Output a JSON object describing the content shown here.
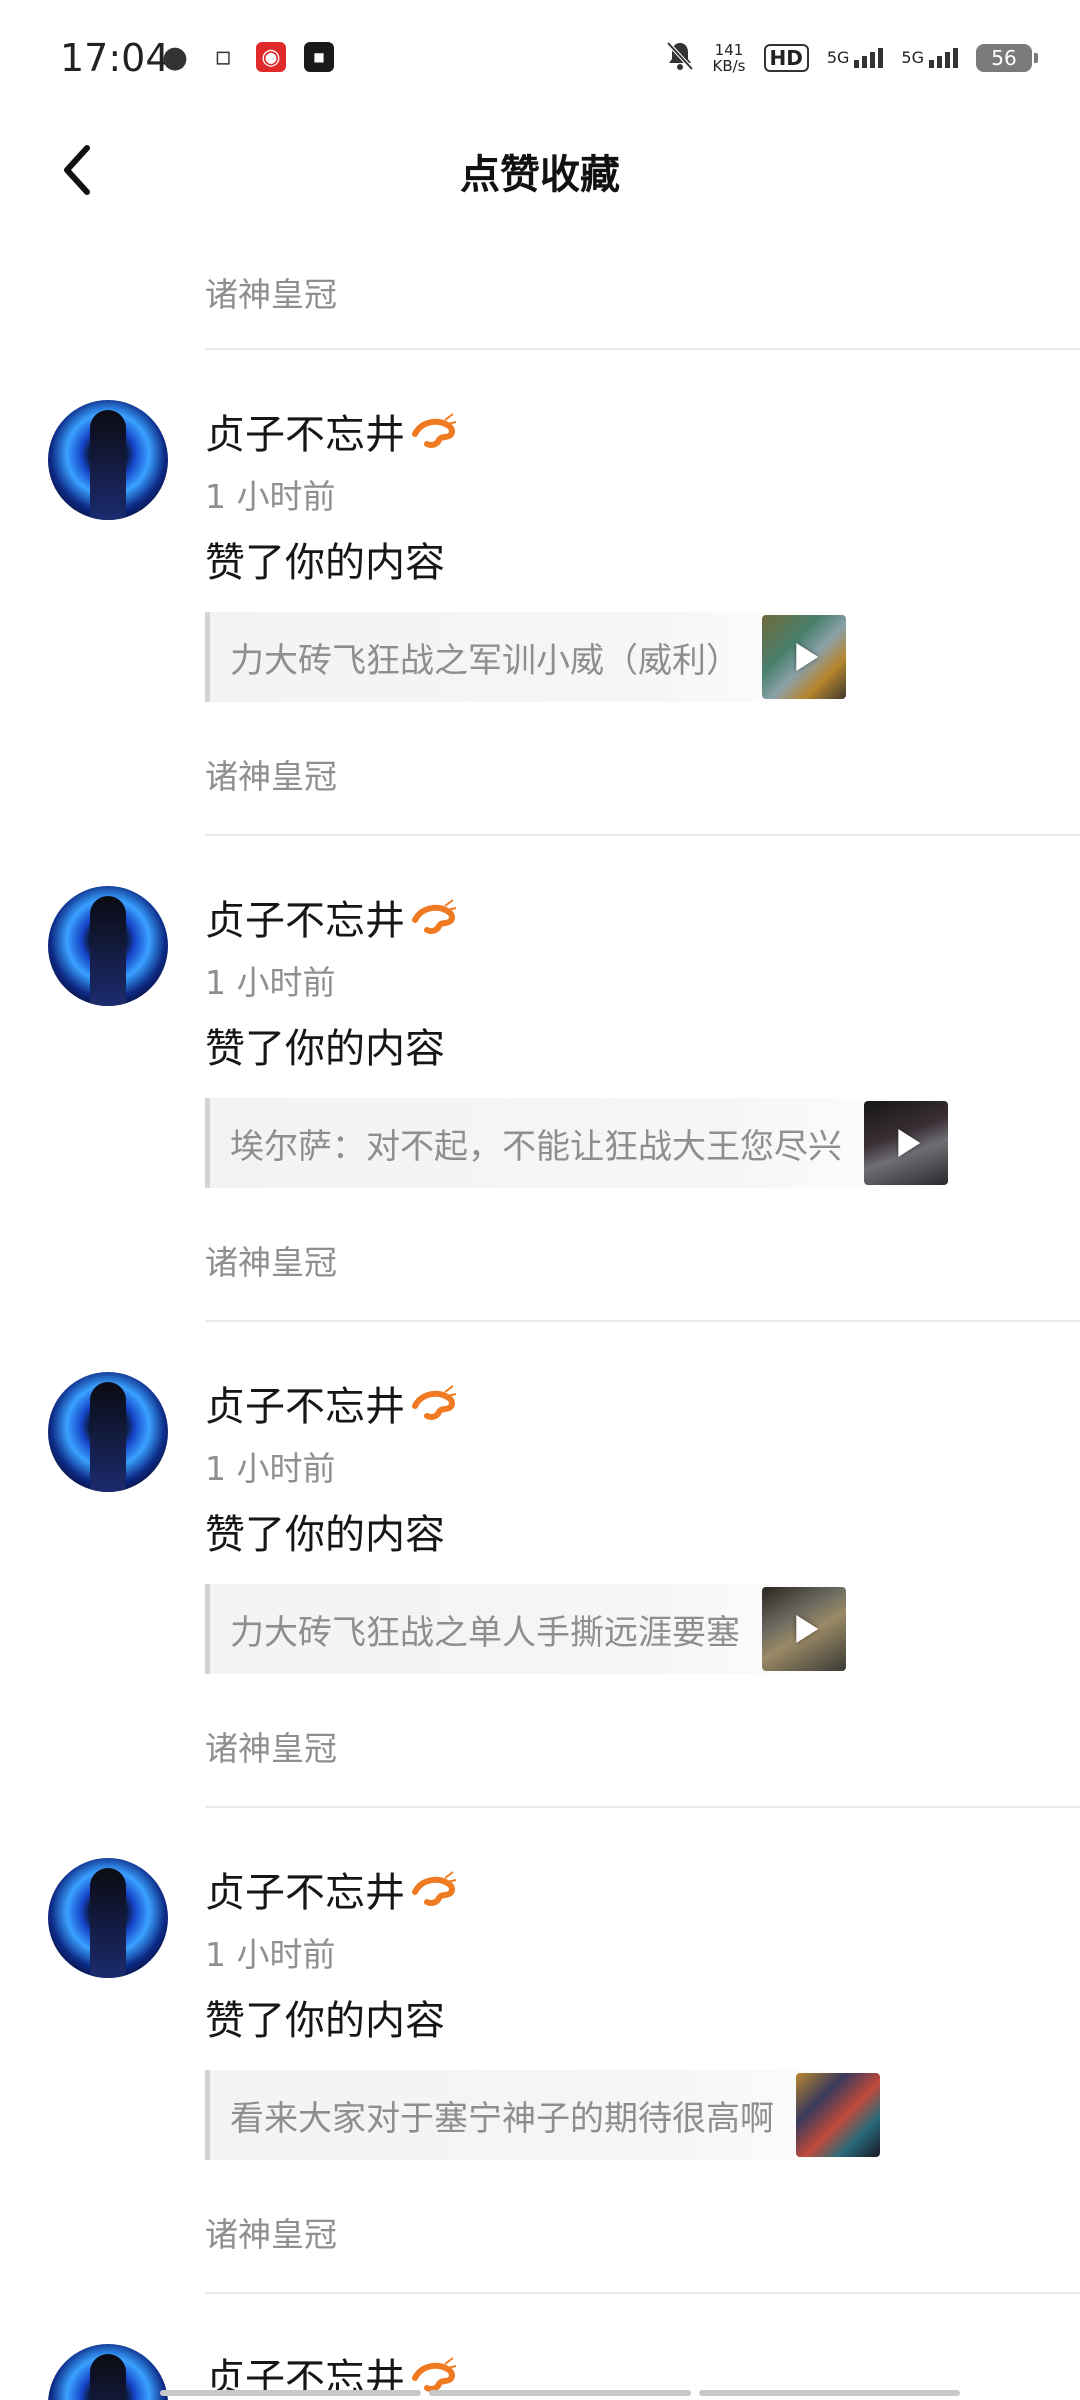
{
  "status_bar": {
    "time": "17:04",
    "net_speed_value": "141",
    "net_speed_unit": "KB/s",
    "hd_label": "HD",
    "sim1_label": "5G",
    "sim2_label": "5G",
    "battery": "56",
    "left_icons": [
      "wechat-icon",
      "bilibili-icon",
      "netease-music-icon",
      "soul-icon"
    ]
  },
  "header": {
    "title": "点赞收藏",
    "back_icon": "chevron-left-icon"
  },
  "top_partial": {
    "source": "诸神皇冠"
  },
  "items": [
    {
      "username": "贞子不忘井",
      "time": "1 小时前",
      "action": "赞了你的内容",
      "quote": "力大砖飞狂战之军训小威（威利）",
      "source": "诸神皇冠"
    },
    {
      "username": "贞子不忘井",
      "time": "1 小时前",
      "action": "赞了你的内容",
      "quote": "埃尔萨：对不起，不能让狂战大王您尽兴",
      "source": "诸神皇冠"
    },
    {
      "username": "贞子不忘井",
      "time": "1 小时前",
      "action": "赞了你的内容",
      "quote": "力大砖飞狂战之单人手撕远涯要塞",
      "source": "诸神皇冠"
    },
    {
      "username": "贞子不忘井",
      "time": "1 小时前",
      "action": "赞了你的内容",
      "quote": "看来大家对于塞宁神子的期待很高啊",
      "source": "诸神皇冠"
    },
    {
      "username": "贞子不忘井"
    }
  ],
  "colors": {
    "secondary_text": "#8f8f8f",
    "divider": "#e9e9e9",
    "quote_bar": "#d3d3d5"
  }
}
